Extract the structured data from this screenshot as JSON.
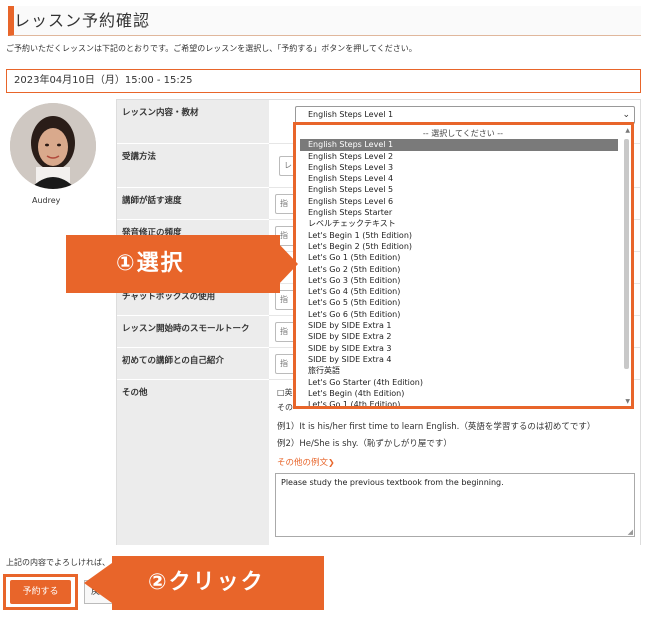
{
  "page": {
    "title": "レッスン予約確認",
    "intro": "ご予約いただくレッスンは下記のとおりです。ご希望のレッスンを選択し、「予約する」ボタンを押してください。",
    "datetime": "2023年04月10日（月）15:00 - 15:25"
  },
  "teacher": {
    "name": "Audrey"
  },
  "form": {
    "rows": [
      {
        "label": "レッスン内容・教材"
      },
      {
        "label": "受講方法"
      },
      {
        "label": "講師が話す速度"
      },
      {
        "label": "発音修正の頻度"
      },
      {
        "label": "チャットボックスの使用"
      },
      {
        "label": "レッスン開始時のスモールトーク"
      },
      {
        "label": "初めての講師との自己紹介"
      },
      {
        "label": "その他"
      }
    ],
    "small_select_partial": [
      "レ",
      "指",
      "指",
      "指",
      "指",
      "指"
    ],
    "selected_material": "English Steps Level 1"
  },
  "dropdown": {
    "options": [
      "-- 選択してください --",
      "English Steps Level 1",
      "English Steps Level 2",
      "English Steps Level 3",
      "English Steps Level 4",
      "English Steps Level 5",
      "English Steps Level 6",
      "English Steps Starter",
      "レベルチェックテキスト",
      "Let's Begin 1 (5th Edition)",
      "Let's Begin 2 (5th Edition)",
      "Let's Go 1 (5th Edition)",
      "Let's Go 2 (5th Edition)",
      "Let's Go 3 (5th Edition)",
      "Let's Go 4 (5th Edition)",
      "Let's Go 5 (5th Edition)",
      "Let's Go 6 (5th Edition)",
      "SIDE by SIDE Extra 1",
      "SIDE by SIDE Extra 2",
      "SIDE by SIDE Extra 3",
      "SIDE by SIDE Extra 4",
      "旅行英語",
      "Let's Go Starter (4th Edition)",
      "Let's Begin (4th Edition)",
      "Let's Go 1 (4th Edition)"
    ],
    "selected_index": 1
  },
  "other": {
    "check_partial": "□英",
    "example_partial": "その",
    "example1": "例1）It is his/her first time to learn English.（英語を学習するのは初めてです）",
    "example2": "例2）He/She is shy.（恥ずかしがり屋です）",
    "more_link": "その他の例文",
    "textarea_value": "Please study the previous textbook from the beginning."
  },
  "footer": {
    "confirm_text": "上記の内容でよろしければ、",
    "reserve_label": "予約する",
    "back_label": "戻る"
  },
  "callouts": {
    "step1": "①選択",
    "step2": "②クリック"
  },
  "colors": {
    "accent": "#e8652a",
    "selected_option": "#7a7a7a"
  }
}
